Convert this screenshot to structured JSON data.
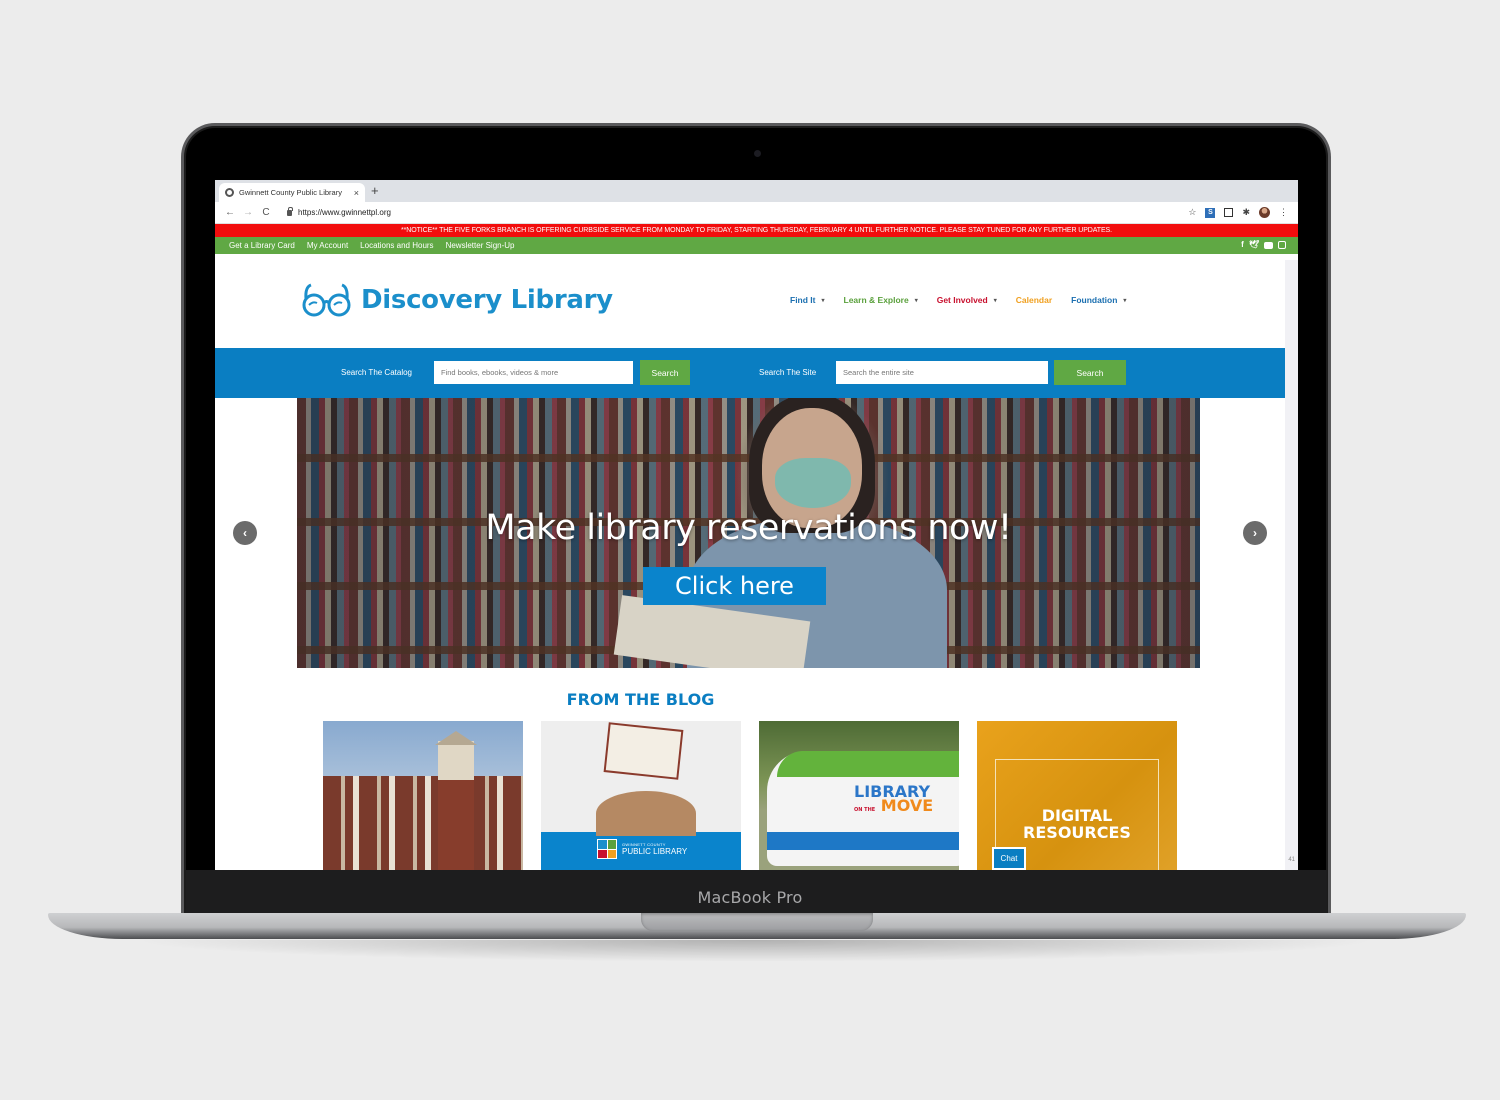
{
  "device": {
    "label": "MacBook Pro"
  },
  "browser": {
    "tab_title": "Gwinnett County Public Library",
    "tab_close": "×",
    "new_tab": "+",
    "url": "https://www.gwinnettpl.org",
    "nav": {
      "back": "←",
      "forward": "→",
      "reload": "C"
    },
    "toolbar_icons": [
      "star-icon",
      "extension-s-icon",
      "extension-qr-icon",
      "puzzle-icon",
      "profile-avatar",
      "menu-icon"
    ],
    "star": "☆",
    "puzzle": "✱",
    "menu": "⋮",
    "ext_s": "S"
  },
  "notice": {
    "text": "**NOTICE** THE FIVE FORKS BRANCH IS OFFERING CURBSIDE SERVICE FROM MONDAY TO FRIDAY, STARTING THURSDAY, FEBRUARY 4 UNTIL FURTHER NOTICE. PLEASE STAY TUNED FOR ANY FURTHER UPDATES.",
    "color": "#f20d0d"
  },
  "utility_nav": {
    "links": [
      "Get a Library Card",
      "My Account",
      "Locations and Hours",
      "Newsletter Sign-Up"
    ],
    "social": {
      "facebook": "f",
      "twitter": "🐦",
      "youtube": "youtube-icon",
      "instagram": "instagram-icon"
    },
    "color": "#60a844"
  },
  "header": {
    "logo_text": "Discovery Library",
    "logo_color": "#1b8fcb",
    "nav": [
      {
        "label": "Find It",
        "color": "#1b6fb0",
        "dropdown": true
      },
      {
        "label": "Learn & Explore",
        "color": "#5aa03c",
        "dropdown": true
      },
      {
        "label": "Get Involved",
        "color": "#c8102e",
        "dropdown": true
      },
      {
        "label": "Calendar",
        "color": "#f0a020",
        "dropdown": false
      },
      {
        "label": "Foundation",
        "color": "#1b6fb0",
        "dropdown": true
      }
    ],
    "caret": "▾"
  },
  "search": {
    "catalog": {
      "label": "Search The Catalog",
      "placeholder": "Find books, ebooks, videos & more",
      "value": "",
      "button": "Search"
    },
    "site": {
      "label": "Search The Site",
      "placeholder": "Search the entire site",
      "value": "",
      "button": "Search"
    },
    "bar_color": "#0a7ec2"
  },
  "carousel": {
    "headline": "Make library reservations now!",
    "cta": "Click here",
    "prev": "‹",
    "next": "›"
  },
  "blog": {
    "title": "FROM THE BLOG",
    "cards": [
      {
        "alt": "Library branch building with clock tower"
      },
      {
        "alt": "Person reading a book",
        "logo_small": "GWINNETT COUNTY",
        "logo_big": "PUBLIC LIBRARY"
      },
      {
        "alt": "Library on the Move van",
        "line1": "LIBRARY",
        "on_the": "ON THE",
        "line2": "MOVE"
      },
      {
        "alt": "Digital Resources",
        "line1": "DIGITAL",
        "line2": "RESOURCES"
      }
    ]
  },
  "chat": {
    "label": "Chat"
  },
  "page_number": "41"
}
